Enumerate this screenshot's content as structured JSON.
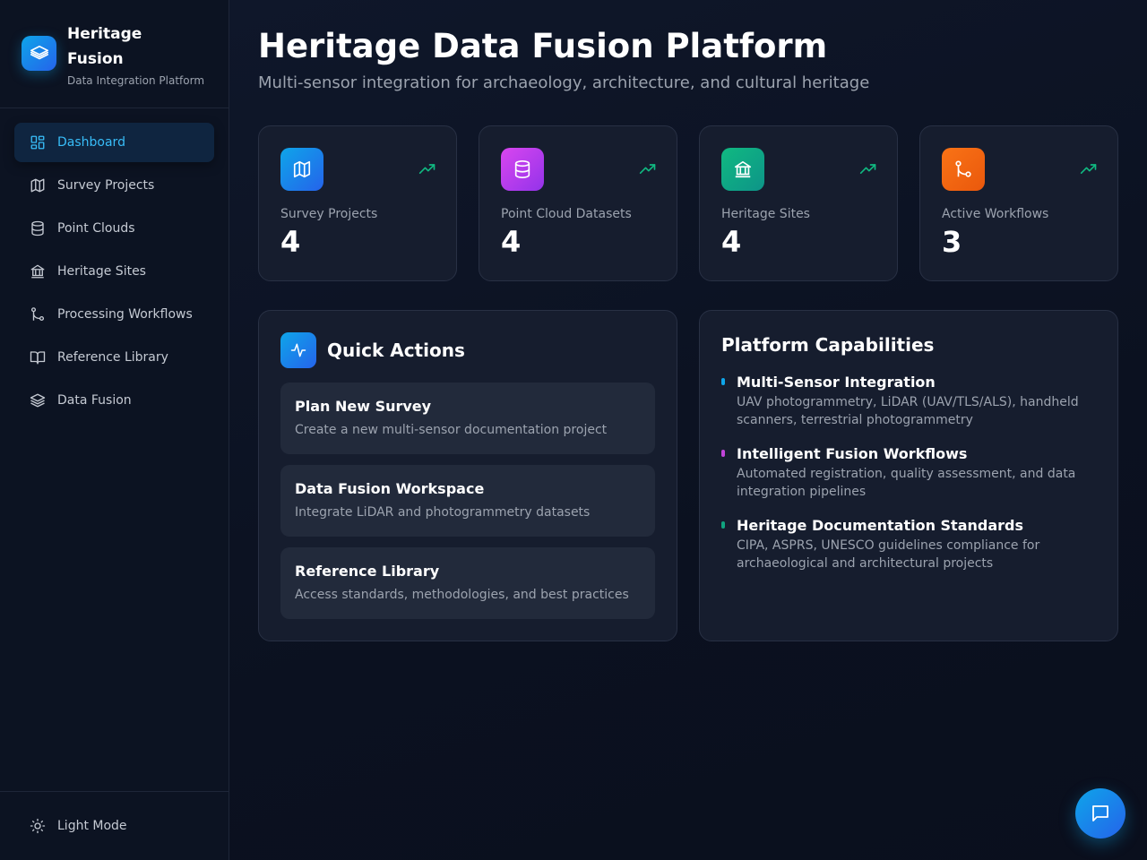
{
  "brand": {
    "title": "Heritage Fusion",
    "subtitle": "Data Integration Platform",
    "icon": "layers-icon",
    "accent": "#0ea5e9"
  },
  "nav": [
    {
      "label": "Dashboard",
      "icon": "dashboard-grid-icon",
      "active": true
    },
    {
      "label": "Survey Projects",
      "icon": "map-icon",
      "active": false
    },
    {
      "label": "Point Clouds",
      "icon": "database-icon",
      "active": false
    },
    {
      "label": "Heritage Sites",
      "icon": "landmark-icon",
      "active": false
    },
    {
      "label": "Processing Workflows",
      "icon": "git-branch-icon",
      "active": false
    },
    {
      "label": "Reference Library",
      "icon": "book-open-icon",
      "active": false
    },
    {
      "label": "Data Fusion",
      "icon": "layers-icon",
      "active": false
    }
  ],
  "theme_toggle": {
    "label": "Light Mode",
    "icon": "sun-icon"
  },
  "header": {
    "title": "Heritage Data Fusion Platform",
    "subtitle": "Multi-sensor integration for archaeology, architecture, and cultural heritage"
  },
  "stats": [
    {
      "label": "Survey Projects",
      "value": "4",
      "icon": "map-icon",
      "color": "#1d8ff0"
    },
    {
      "label": "Point Cloud Datasets",
      "value": "4",
      "icon": "database-icon",
      "color": "#c044d8"
    },
    {
      "label": "Heritage Sites",
      "value": "4",
      "icon": "landmark-icon",
      "color": "#10a37f"
    },
    {
      "label": "Active Workflows",
      "value": "3",
      "icon": "git-branch-icon",
      "color": "#f97316"
    }
  ],
  "quick_actions": {
    "title": "Quick Actions",
    "icon": "activity-icon",
    "items": [
      {
        "title": "Plan New Survey",
        "desc": "Create a new multi-sensor documentation project"
      },
      {
        "title": "Data Fusion Workspace",
        "desc": "Integrate LiDAR and photogrammetry datasets"
      },
      {
        "title": "Reference Library",
        "desc": "Access standards, methodologies, and best practices"
      }
    ]
  },
  "capabilities": {
    "title": "Platform Capabilities",
    "items": [
      {
        "name": "Multi-Sensor Integration",
        "desc": "UAV photogrammetry, LiDAR (UAV/TLS/ALS), handheld scanners, terrestrial photogrammetry",
        "color": "#0ea5e9"
      },
      {
        "name": "Intelligent Fusion Workflows",
        "desc": "Automated registration, quality assessment, and data integration pipelines",
        "color": "#c044d8"
      },
      {
        "name": "Heritage Documentation Standards",
        "desc": "CIPA, ASPRS, UNESCO guidelines compliance for archaeological and architectural projects",
        "color": "#10a37f"
      }
    ]
  },
  "chat": {
    "icon": "message-square-icon"
  }
}
